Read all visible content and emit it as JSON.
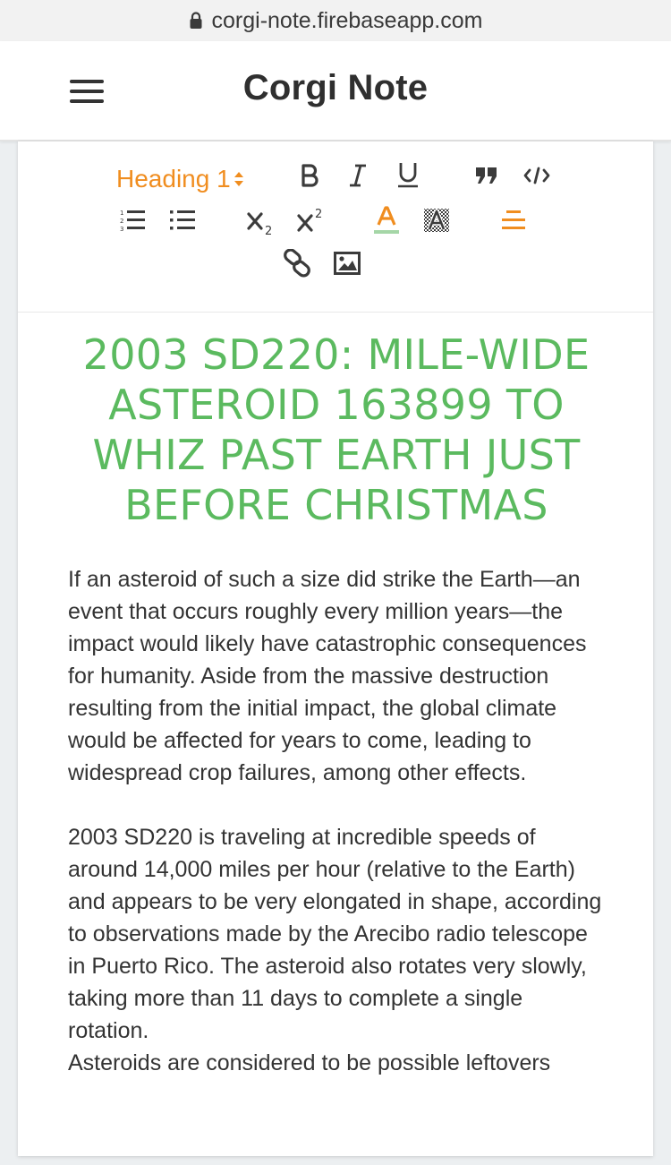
{
  "browser": {
    "url": "corgi-note.firebaseapp.com"
  },
  "header": {
    "title": "Corgi Note"
  },
  "toolbar": {
    "heading_label": "Heading 1",
    "colors": {
      "accent": "#f08d1f",
      "text_color_underline": "#a5d6a7",
      "heading_green": "#5bba5f"
    },
    "icons": [
      "bold-icon",
      "italic-icon",
      "underline-icon",
      "blockquote-icon",
      "code-icon",
      "ordered-list-icon",
      "bullet-list-icon",
      "subscript-icon",
      "superscript-icon",
      "text-color-icon",
      "highlight-color-icon",
      "align-icon",
      "link-icon",
      "image-icon"
    ]
  },
  "editor": {
    "title": "2003 SD220: MILE-WIDE ASTEROID 163899 TO WHIZ PAST EARTH JUST BEFORE CHRISTMAS",
    "paragraphs": [
      "If an asteroid of such a size did strike the Earth—an event that occurs roughly every million years—the impact would likely have catastrophic consequences for humanity. Aside from the massive destruction resulting from the initial impact, the global climate would be affected for years to come, leading to widespread crop failures, among other effects.",
      "2003 SD220 is traveling at incredible speeds of around 14,000 miles per hour (relative to the Earth) and appears to be very elongated in shape, according to observations made by the Arecibo radio telescope in Puerto Rico. The asteroid also rotates very slowly, taking more than 11 days to complete a single rotation.",
      "Asteroids are considered to be possible leftovers"
    ]
  }
}
